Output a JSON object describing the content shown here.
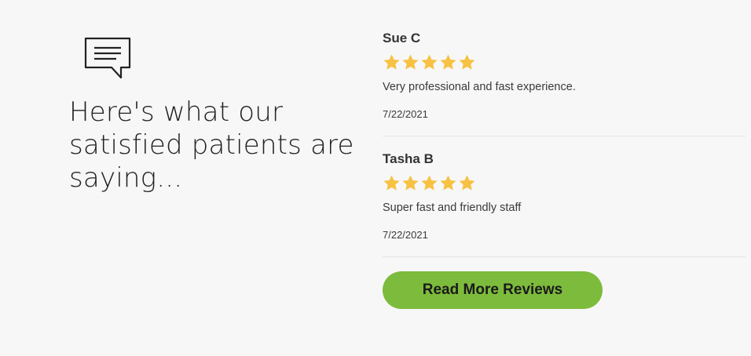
{
  "headline": "Here's what our satisfied patients are saying...",
  "icons": {
    "chat": "chat-bubble-icon",
    "star": "star-icon"
  },
  "colors": {
    "star": "#f7c142",
    "button": "#7dbb3c",
    "background": "#f7f7f7"
  },
  "reviews": [
    {
      "name": "Sue C",
      "rating": 5,
      "text": "Very professional and fast experience.",
      "date": "7/22/2021"
    },
    {
      "name": "Tasha B",
      "rating": 5,
      "text": "Super fast and friendly staff",
      "date": "7/22/2021"
    }
  ],
  "button": {
    "label": "Read More Reviews"
  }
}
